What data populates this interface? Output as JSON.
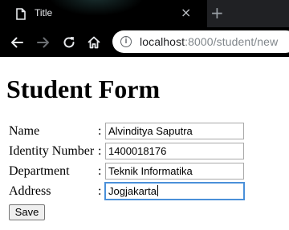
{
  "browser": {
    "tab": {
      "title": "Title",
      "close_glyph": "×"
    },
    "new_tab_glyph": "+",
    "address": {
      "host": "localhost",
      "rest": ":8000/student/new",
      "info_glyph": "i"
    },
    "icons": [
      "page-icon",
      "close-icon",
      "plus-icon",
      "back-arrow-icon",
      "forward-arrow-icon",
      "reload-icon",
      "home-icon",
      "info-icon"
    ],
    "colors": {
      "tab_bar": "#202124",
      "toolbar": "#000000",
      "omnibox": "#ffffff"
    }
  },
  "page": {
    "title": "Student Form",
    "fields": [
      {
        "label": "Name",
        "separator": ":",
        "value": "Alvinditya Saputra"
      },
      {
        "label": "Identity Number",
        "separator": ":",
        "value": "1400018176"
      },
      {
        "label": "Department",
        "separator": ":",
        "value": "Teknik Informatika"
      },
      {
        "label": "Address",
        "separator": ":",
        "value": "Jogjakarta"
      }
    ],
    "save_label": "Save"
  }
}
